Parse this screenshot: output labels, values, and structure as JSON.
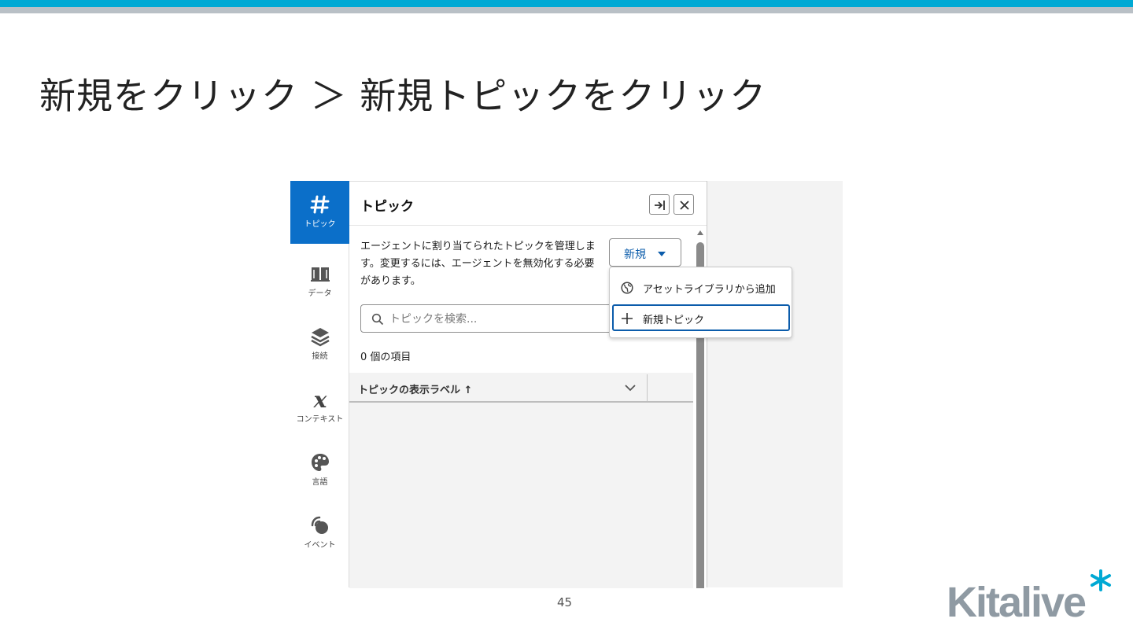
{
  "slide": {
    "title": "新規をクリック ＞ 新規トピックをクリック",
    "page_number": "45"
  },
  "rail": {
    "items": [
      {
        "label": "トピック",
        "icon": "hash-icon",
        "active": true
      },
      {
        "label": "データ",
        "icon": "book-icon"
      },
      {
        "label": "接続",
        "icon": "layers-icon"
      },
      {
        "label": "コンテキスト",
        "icon": "variable-x-icon"
      },
      {
        "label": "言語",
        "icon": "palette-icon"
      },
      {
        "label": "イベント",
        "icon": "signal-icon"
      }
    ]
  },
  "panel": {
    "title": "トピック",
    "description": "エージェントに割り当てられたトピックを管理します。変更するには、エージェントを無効化する必要があります。",
    "new_button_label": "新規",
    "search_placeholder": "トピックを検索...",
    "item_count": "0 個の項目",
    "column_header": "トピックの表示ラベル ↑"
  },
  "dropdown": {
    "items": [
      {
        "label": "アセットライブラリから追加",
        "icon": "globe-icon"
      },
      {
        "label": "新規トピック",
        "icon": "plus-icon",
        "focused": true
      }
    ]
  },
  "logo": {
    "text": "Kitalive",
    "colors": {
      "text": "#8f9aa3",
      "asterisk": "#00a9d4"
    }
  },
  "colors": {
    "accent_bar": "#00a9d4",
    "secondary_bar": "#b9c0c6",
    "active_tab": "#0b6fc9",
    "link_blue": "#0b5cab"
  }
}
